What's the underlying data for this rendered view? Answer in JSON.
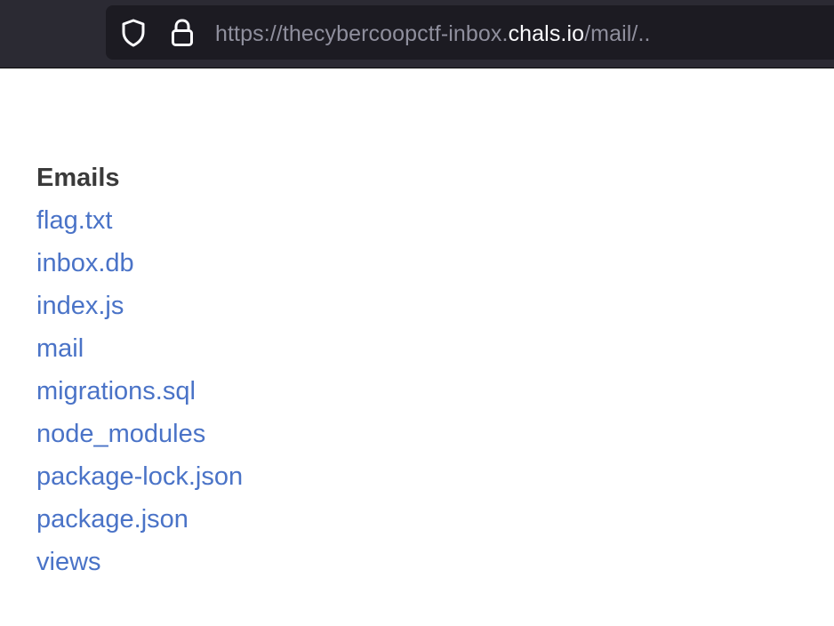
{
  "browser": {
    "url_prefix": "https://thecybercoopctf-inbox.",
    "url_host": "chals.io",
    "url_suffix": "/mail/..",
    "icons": [
      "shield-icon",
      "lock-icon"
    ]
  },
  "page": {
    "heading": "Emails",
    "links": [
      "flag.txt",
      "inbox.db",
      "index.js",
      "mail",
      "migrations.sql",
      "node_modules",
      "package-lock.json",
      "package.json",
      "views"
    ]
  },
  "colors": {
    "toolbar": "#2b2a33",
    "urlbar": "#1c1b22",
    "link": "#4a73c7",
    "heading": "#3a3a3a"
  }
}
